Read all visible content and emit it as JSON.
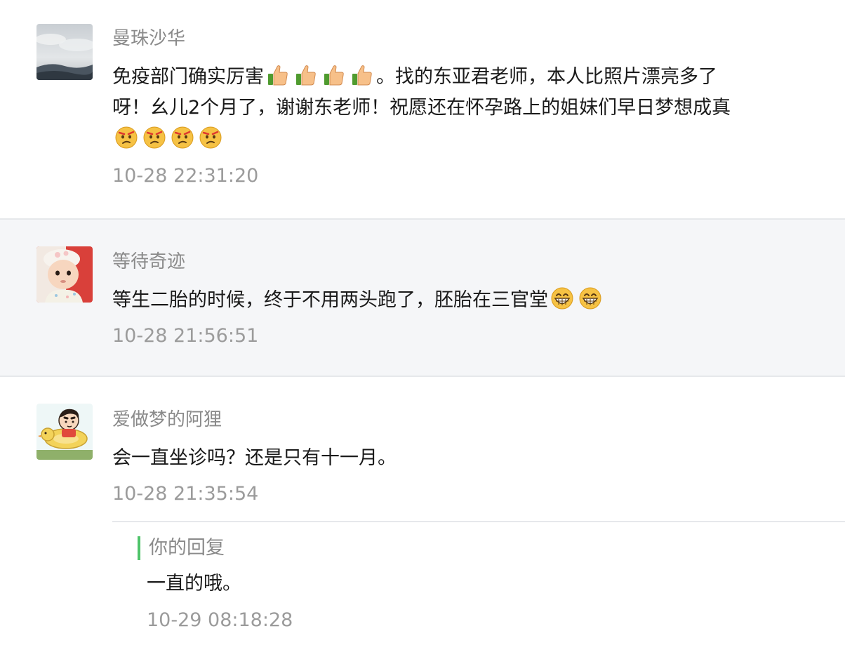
{
  "comments": [
    {
      "nickname": "曼珠沙华",
      "text_1": "免疫部门确实厉害",
      "emoji_1": [
        "thumbs-up-icon",
        "thumbs-up-icon",
        "thumbs-up-icon",
        "thumbs-up-icon"
      ],
      "text_2": "。找的东亚君老师，本人比照片漂亮多了呀！幺儿2个月了，谢谢东老师！祝愿还在怀孕路上的姐妹们早日梦想成真",
      "emoji_2": [
        "frown-face-icon",
        "frown-face-icon",
        "frown-face-icon",
        "frown-face-icon"
      ],
      "time": "10-28 22:31:20",
      "avatar": "landscape-avatar"
    },
    {
      "nickname": "等待奇迹",
      "text_1": "等生二胎的时候，终于不用两头跑了，胚胎在三官堂",
      "emoji_1": [
        "grin-face-icon",
        "grin-face-icon"
      ],
      "time": "10-28 21:56:51",
      "avatar": "baby-avatar"
    },
    {
      "nickname": "爱做梦的阿狸",
      "text_1": "会一直坐诊吗？还是只有十一月。",
      "time": "10-28 21:35:54",
      "avatar": "cartoon-avatar",
      "reply": {
        "label": "你的回复",
        "text": "一直的哦。",
        "time": "10-29 08:18:28"
      }
    }
  ],
  "colors": {
    "reply_bar": "#4fc46a",
    "nickname": "#8a8a8a",
    "timestamp": "#9b9b9b",
    "highlight_bg": "#f5f6f8"
  }
}
